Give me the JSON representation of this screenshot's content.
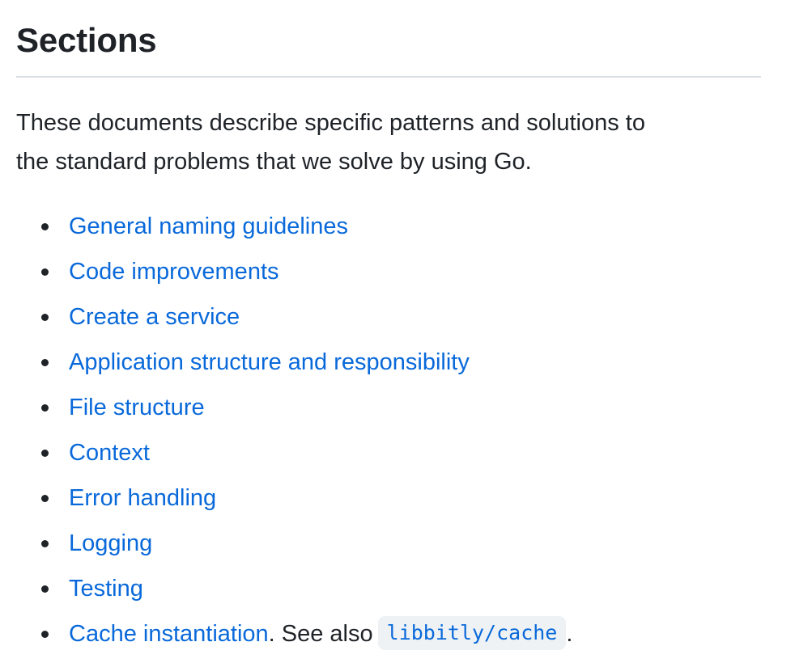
{
  "heading": "Sections",
  "intro": {
    "line1": "These documents describe specific patterns and solutions to",
    "line2": "the standard problems that we solve by using Go."
  },
  "links": [
    {
      "label": "General naming guidelines"
    },
    {
      "label": "Code improvements"
    },
    {
      "label": "Create a service"
    },
    {
      "label": "Application structure and responsibility"
    },
    {
      "label": "File structure"
    },
    {
      "label": "Context"
    },
    {
      "label": "Error handling"
    },
    {
      "label": "Logging"
    },
    {
      "label": "Testing"
    },
    {
      "label": "Cache instantiation"
    }
  ],
  "last_item": {
    "see_also_text": ". See also",
    "code_link": "libbitly/cache",
    "end_punct": "."
  },
  "colors": {
    "text": "#1f2328",
    "link": "#0969da",
    "rule": "#d8dee4",
    "code_bg": "#eff2f5"
  }
}
